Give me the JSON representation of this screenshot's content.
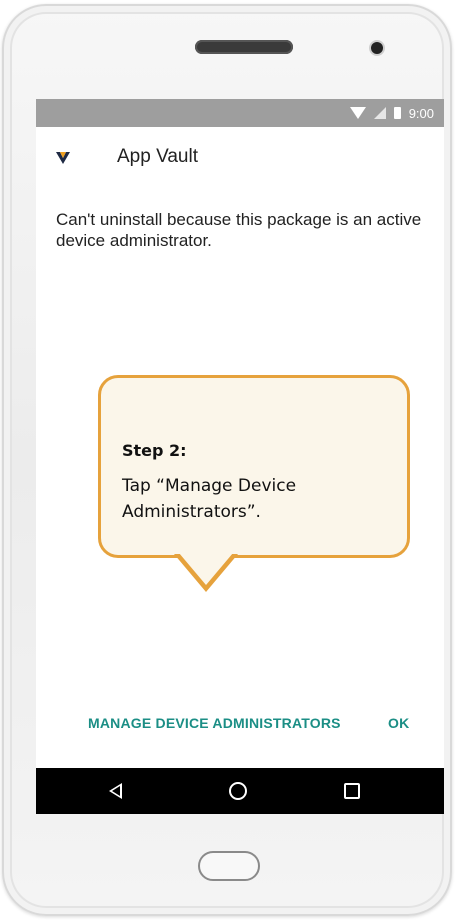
{
  "status_bar": {
    "time": "9:00",
    "icons": [
      "wifi-icon",
      "no-sim-icon",
      "battery-icon"
    ]
  },
  "dialog": {
    "app_name": "App Vault",
    "app_icon": "app-vault-logo",
    "message": "Can't uninstall because this package is an active device administrator.",
    "buttons": {
      "manage_label": "MANAGE DEVICE ADMINISTRATORS",
      "ok_label": "OK"
    }
  },
  "callout": {
    "title": "Step 2:",
    "text": "Tap “Manage Device Administrators”."
  },
  "navigation": {
    "buttons": [
      "back-icon",
      "home-icon",
      "recents-icon"
    ]
  },
  "colors": {
    "accent": "#1b8e85",
    "callout_border": "#e6a23c",
    "callout_fill": "#fbf6ea",
    "status_bar": "#9e9e9e"
  }
}
